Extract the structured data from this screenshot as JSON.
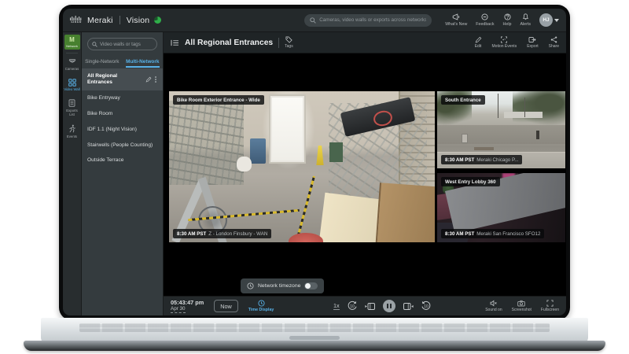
{
  "topbar": {
    "brand": {
      "cisco": "cisco",
      "meraki": "Meraki",
      "product": "Vision"
    },
    "search_placeholder": "Cameras, video walls or exports across networks",
    "actions": [
      {
        "label": "What's New"
      },
      {
        "label": "Feedback"
      },
      {
        "label": "Help"
      },
      {
        "label": "Alerts"
      }
    ],
    "avatar_initials": "HJ"
  },
  "rail": {
    "network_badge": {
      "letter": "M",
      "label": "Network"
    },
    "items": [
      {
        "label": "Cameras"
      },
      {
        "label": "Video Wall",
        "active": true
      },
      {
        "label": "Exports List"
      },
      {
        "label": "Events"
      }
    ]
  },
  "sidebar": {
    "search_placeholder": "Video walls or tags",
    "tabs": [
      {
        "label": "Single-Network",
        "active": false
      },
      {
        "label": "Multi-Network",
        "active": true
      }
    ],
    "items": [
      {
        "label": "All Regional Entrances",
        "selected": true
      },
      {
        "label": "Bike Entryway"
      },
      {
        "label": "Bike Room"
      },
      {
        "label": "IDF 1.1 (Night Vision)"
      },
      {
        "label": "Stairwells (People Counting)"
      },
      {
        "label": "Outside Terrace"
      }
    ]
  },
  "header": {
    "title": "All Regional Entrances",
    "tags_label": "Tags",
    "actions": [
      {
        "label": "Edit"
      },
      {
        "label": "Motion Events"
      },
      {
        "label": "Export"
      },
      {
        "label": "Share"
      }
    ]
  },
  "cameras": [
    {
      "name": "Bike Room Exterior Entrance - Wide",
      "time": "8:30 AM PST",
      "network": "Z - London Finsbury - WAN"
    },
    {
      "name": "South Entrance",
      "time": "8:30 AM PST",
      "network": "Meraki Chicago P..."
    },
    {
      "name": "West Entry Lobby 360",
      "time": "8:30 AM PST",
      "network": "Meraki San Francisco SFO12"
    }
  ],
  "timeline": {
    "timezone_label": "Network timezone",
    "timezone_on": false,
    "current_time": "05:43:47 pm",
    "current_date": "Apr 30",
    "now_label": "Now",
    "time_display_label": "Time Display",
    "speed": "1x",
    "skip_amount": "10",
    "playing": true,
    "right_actions": [
      {
        "label": "Sound on"
      },
      {
        "label": "Screenshot"
      },
      {
        "label": "Fullscreen"
      }
    ]
  },
  "colors": {
    "accent_blue": "#58b1e7",
    "network_green": "#47802f",
    "topbar_bg": "#24292b",
    "sidebar_bg": "#343b3e",
    "stage_bg": "#000000"
  }
}
